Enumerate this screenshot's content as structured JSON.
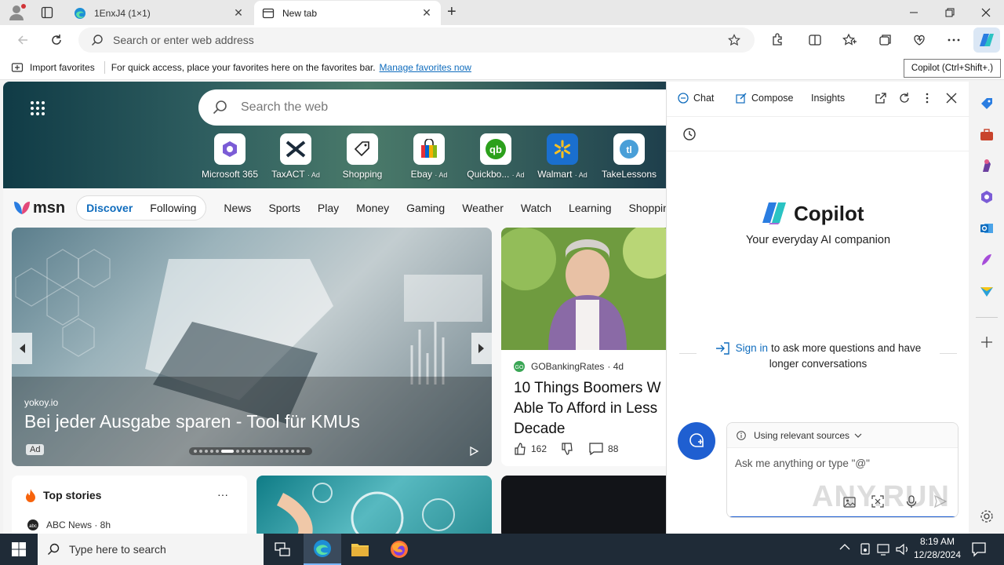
{
  "tabs": [
    {
      "title": "1EnxJ4 (1×1)"
    },
    {
      "title": "New tab"
    }
  ],
  "toolbar": {
    "address_placeholder": "Search or enter web address"
  },
  "favorites_bar": {
    "import": "Import favorites",
    "message": "For quick access, place your favorites here on the favorites bar.",
    "manage_link": "Manage favorites now"
  },
  "tooltip": "Copilot (Ctrl+Shift+.)",
  "newtab": {
    "search_placeholder": "Search the web",
    "quick_links": [
      {
        "label": "Microsoft 365",
        "ad": ""
      },
      {
        "label": "TaxACT",
        "ad": "· Ad"
      },
      {
        "label": "Shopping",
        "ad": ""
      },
      {
        "label": "Ebay",
        "ad": "· Ad"
      },
      {
        "label": "Quickbo...",
        "ad": "· Ad"
      },
      {
        "label": "Walmart",
        "ad": "· Ad"
      },
      {
        "label": "TakeLessons",
        "ad": ""
      }
    ],
    "msn_logo": "msn",
    "pill": [
      "Discover",
      "Following"
    ],
    "nav": [
      "News",
      "Sports",
      "Play",
      "Money",
      "Gaming",
      "Weather",
      "Watch",
      "Learning",
      "Shoppin"
    ],
    "carousel": {
      "source": "yokoy.io",
      "headline": "Bei jeder Ausgabe sparen - Tool für KMUs",
      "ad_badge": "Ad",
      "dots_total": 19,
      "dots_active": 6
    },
    "card2": {
      "source": "GOBankingRates",
      "age": "· 4d",
      "headline": "10 Things Boomers W Able To Afford in Less Decade",
      "headline_lines": [
        "10 Things Boomers W",
        "Able To Afford in Less",
        "Decade"
      ],
      "likes": "162",
      "comments": "88"
    },
    "top_stories": {
      "title": "Top stories",
      "more": "···",
      "first_source": "ABC News · 8h"
    }
  },
  "copilot": {
    "tabs": [
      "Chat",
      "Compose",
      "Insights"
    ],
    "brand": "Copilot",
    "tagline": "Your everyday AI companion",
    "signin_link": "Sign in",
    "signin_rest": "to ask more questions and have",
    "signin_rest2": "longer conversations",
    "sources": "Using relevant sources",
    "input_placeholder": "Ask me anything or type \"@\""
  },
  "taskbar": {
    "search_placeholder": "Type here to search",
    "time": "8:19 AM",
    "date": "12/28/2024"
  },
  "watermark": "ANY.RUN",
  "colors": {
    "accent": "#0f6cbd",
    "link": "#0f6cbd",
    "taskbar": "#1f2b37"
  }
}
